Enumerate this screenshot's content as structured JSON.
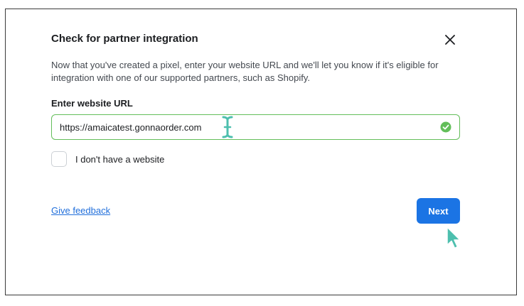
{
  "dialog": {
    "title": "Check for partner integration",
    "close_icon": "close-icon",
    "description": "Now that you've created a pixel, enter your website URL and we'll let you know if it's eligible for integration with one of our supported partners, such as Shopify."
  },
  "url_field": {
    "label": "Enter website URL",
    "value": "https://amaicatest.gonnaorder.com",
    "status_icon": "check-circle-icon",
    "status_color": "#63be5a"
  },
  "no_website": {
    "label": "I don't have a website",
    "checked": false
  },
  "footer": {
    "feedback_link": "Give feedback",
    "next_button": "Next"
  },
  "colors": {
    "primary": "#1b74e4",
    "link": "#216fdb",
    "valid_border": "#63be5a",
    "cursor_overlay": "#4dbfae"
  }
}
